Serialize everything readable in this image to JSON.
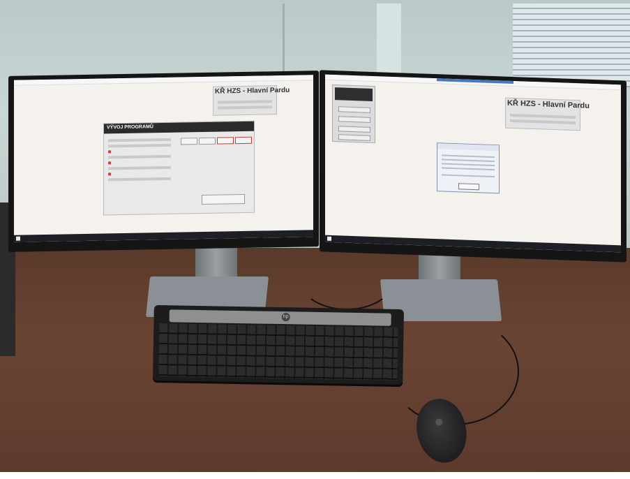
{
  "scene": {
    "description_type": "photo",
    "left_screen": {
      "logo": "KŘ HZS - Hlavní Pardu",
      "panel_title": "VÝVOJ PROGRAMŮ"
    },
    "right_screen": {
      "logo": "KŘ HZS - Hlavní Pardu"
    },
    "keyboard_brand": "hp"
  }
}
